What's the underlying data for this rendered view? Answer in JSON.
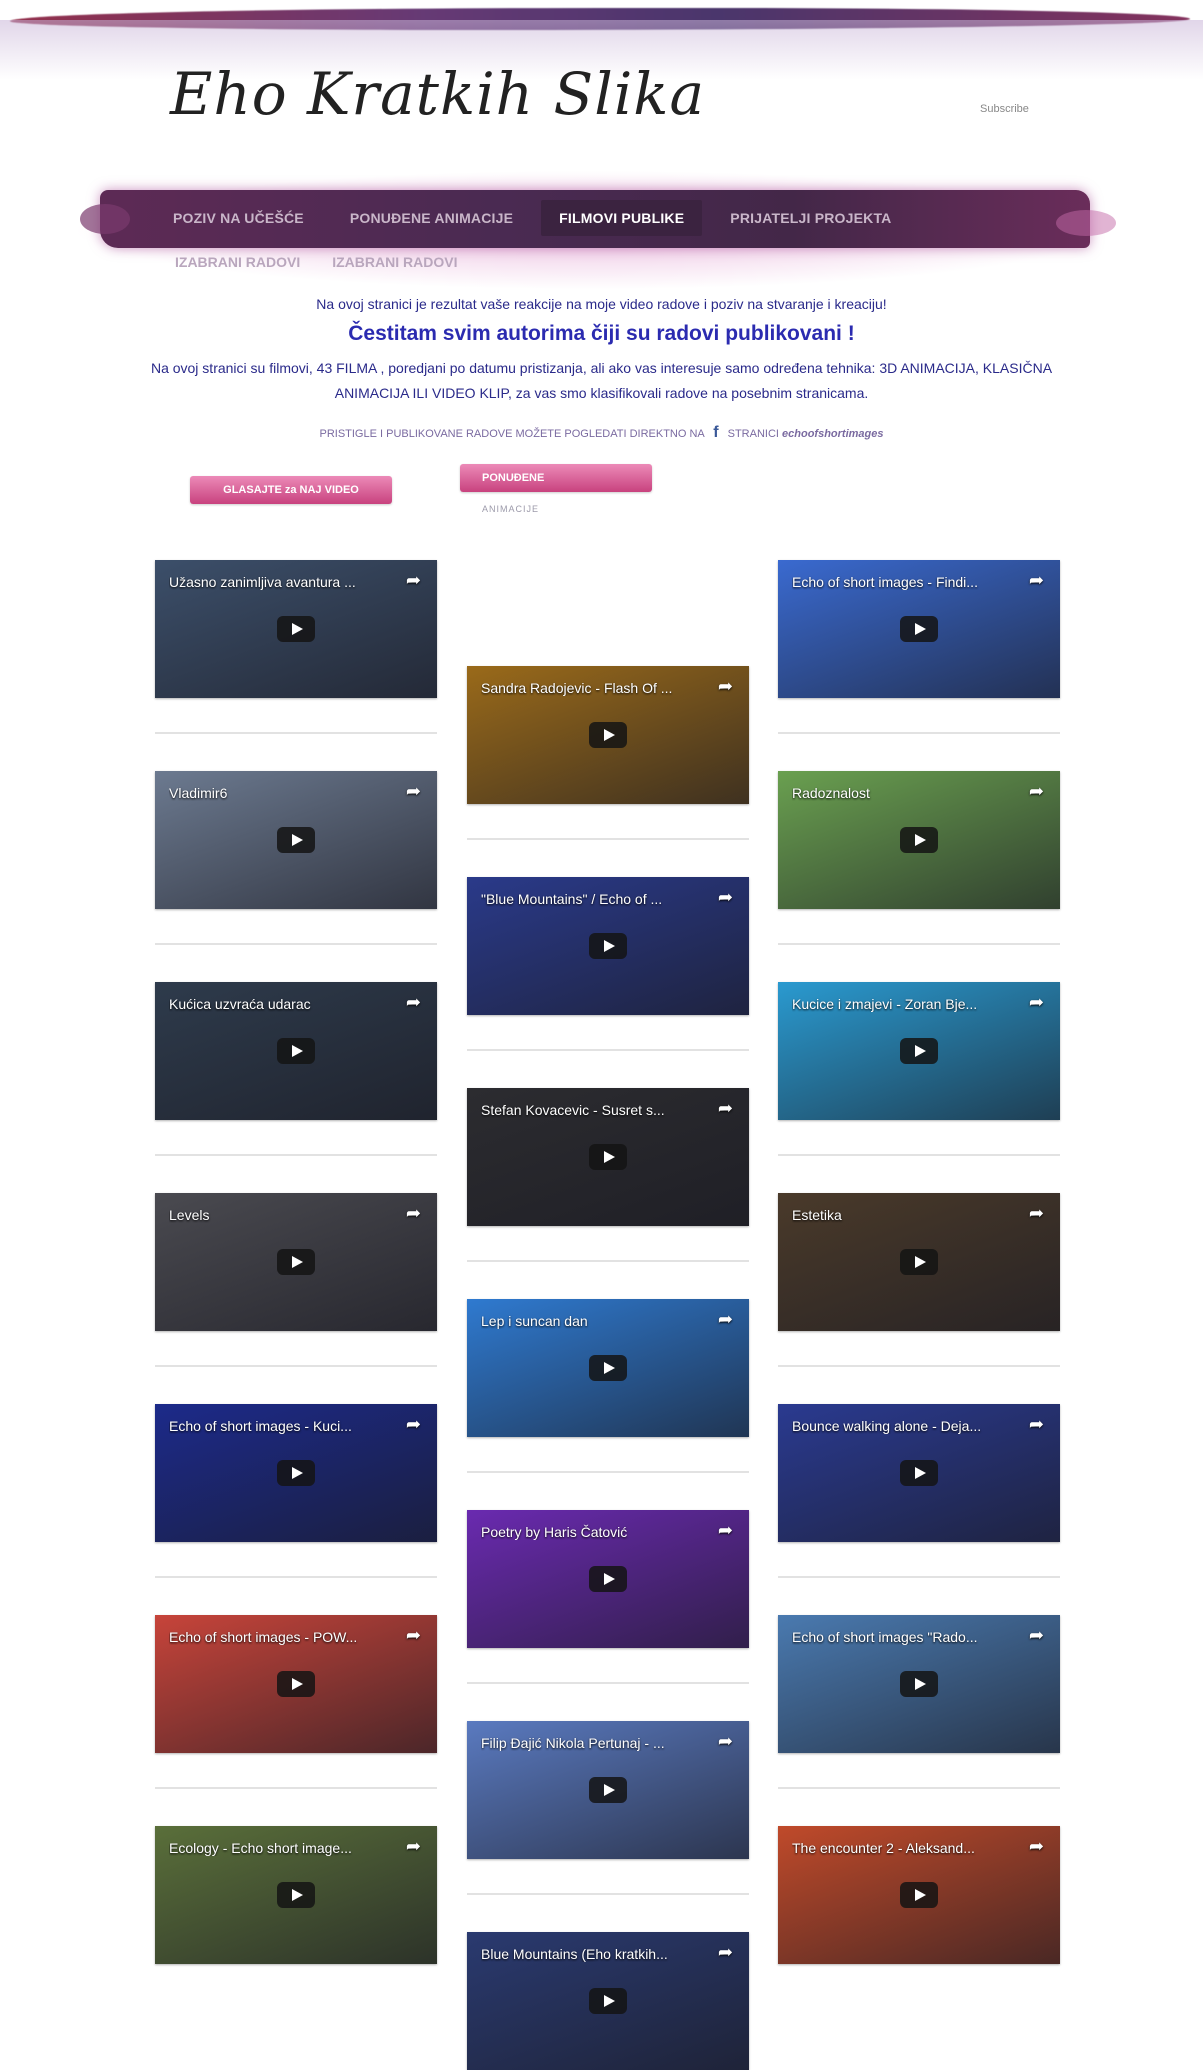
{
  "site": {
    "title": "Eho Kratkih Slika",
    "subscribe": "Subscribe"
  },
  "nav": {
    "items": [
      {
        "label": "POZIV NA UČEŠĆE"
      },
      {
        "label": "PONUĐENE ANIMACIJE"
      },
      {
        "label": "FILMOVI PUBLIKE",
        "active": true
      },
      {
        "label": "PRIJATELJI PROJEKTA"
      }
    ],
    "sub": [
      "IZABRANI RADOVI",
      "IZABRANI RADOVI"
    ]
  },
  "intro": {
    "line1": "Na ovoj stranici je rezultat vaše reakcije na moje video radove i poziv na stvaranje i kreaciju!",
    "headline": "Čestitam svim autorima čiji su radovi publikovani !",
    "line3": "Na ovoj stranici su filmovi, 43 FILMA , poredjani po datumu pristizanja, ali ako vas interesuje samo određena tehnika: 3D ANIMACIJA, KLASIČNA ANIMACIJA ILI VIDEO KLIP, za vas smo klasifikovali radove na posebnim stranicama.",
    "fb_prefix": "PRISTIGLE I PUBLIKOVANE RADOVE MOŽETE POGLEDATI DIREKTNO NA",
    "fb_icon": "f",
    "fb_suffix": "STRANICI",
    "fb_page": "echoofshortimages"
  },
  "buttons": {
    "vote": "GLASAJTE za NAJ VIDEO",
    "offered": "PONUĐENE",
    "offered_sub": "ANIMACIJE"
  },
  "colors": {
    "nav_bg": "#4a2a52",
    "accent_pink": "#d65a95",
    "text_blue": "#2b2bb0"
  },
  "videos": {
    "left": [
      {
        "title": "Užasno zanimljiva avantura ..."
      },
      {
        "title": "Vladimir6"
      },
      {
        "title": "Kućica uzvraća udarac"
      },
      {
        "title": "Levels"
      },
      {
        "title": "Echo of short images - Kuci..."
      },
      {
        "title": "Echo of short images - POW..."
      },
      {
        "title": "Ecology - Echo short image..."
      }
    ],
    "middle": [
      {
        "title": "Sandra Radojevic - Flash Of ..."
      },
      {
        "title": "\"Blue Mountains\" / Echo of ..."
      },
      {
        "title": "Stefan Kovacevic - Susret s..."
      },
      {
        "title": "Lep i suncan dan"
      },
      {
        "title": "Poetry by Haris Čatović"
      },
      {
        "title": "Filip Đajić Nikola Pertunaj - ..."
      },
      {
        "title": "Blue Mountains (Eho kratkih..."
      }
    ],
    "right": [
      {
        "title": "Echo of short images - Findi..."
      },
      {
        "title": "Radoznalost"
      },
      {
        "title": "Kucice i zmajevi - Zoran Bje..."
      },
      {
        "title": "Estetika"
      },
      {
        "title": "Bounce walking alone - Deja..."
      },
      {
        "title": "Echo of short images \"Rado..."
      },
      {
        "title": "The encounter 2 - Aleksand..."
      }
    ]
  }
}
